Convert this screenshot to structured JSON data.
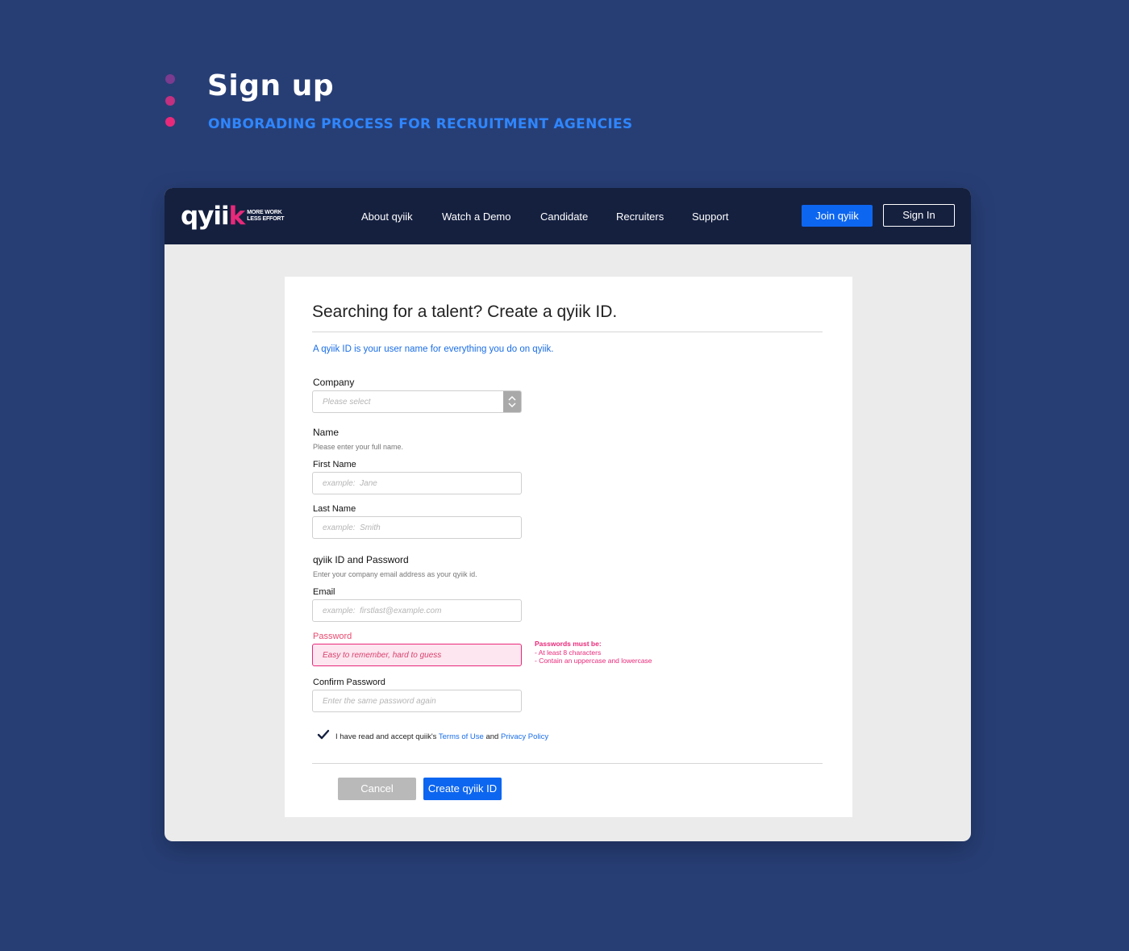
{
  "hero": {
    "title": "Sign up",
    "subtitle": "ONBORADING PROCESS FOR RECRUITMENT AGENCIES"
  },
  "app": {
    "logo": {
      "wordmark": "qyii",
      "wordmark_k": "k",
      "tagline_1": "MORE WORK",
      "tagline_2": "LESS EFFORT"
    },
    "nav": [
      "About qyiik",
      "Watch a Demo",
      "Candidate",
      "Recruiters",
      "Support"
    ],
    "join_label": "Join qyiik",
    "signin_label": "Sign In"
  },
  "form": {
    "title": "Searching for a talent?  Create a qyiik ID.",
    "intro": "A qyiik ID is your user name for everything you do on qyiik.",
    "company": {
      "label": "Company",
      "placeholder": "Please select"
    },
    "name": {
      "label": "Name",
      "help": "Please enter your full name.",
      "first_label": "First Name",
      "first_placeholder": "example:  Jane",
      "last_label": "Last Name",
      "last_placeholder": "example:  Smith"
    },
    "credentials": {
      "label": "qyiik ID and Password",
      "help": "Enter your company email address as your qyiik id.",
      "email_label": "Email",
      "email_placeholder": "example:  firstlast@example.com",
      "password_label": "Password",
      "password_placeholder": "Easy to remember, hard to guess",
      "rules_title": "Passwords must be:",
      "rules": [
        "- At least 8 characters",
        "- Contain an uppercase and lowercase"
      ],
      "confirm_label": "Confirm Password",
      "confirm_placeholder": "Enter the same password again"
    },
    "terms": {
      "prefix": "I have read and accept quiik's ",
      "terms_link": "Terms of Use",
      "middle": " and ",
      "privacy_link": "Privacy Policy",
      "checked": true
    },
    "cancel_label": "Cancel",
    "create_label": "Create qyiik ID"
  },
  "colors": {
    "background": "#273e75",
    "accent_blue": "#0d66f0",
    "accent_pink": "#e8297a",
    "topbar": "#15203f"
  }
}
